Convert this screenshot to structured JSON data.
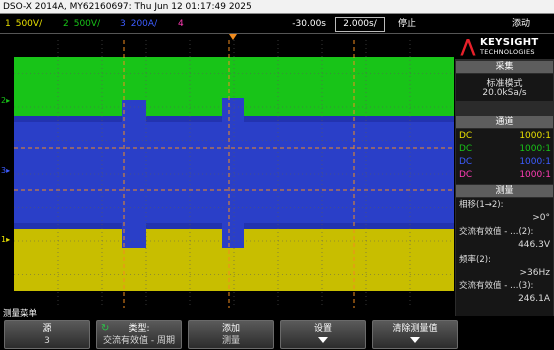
{
  "title_bar": "DSO-X 2014A, MY62160697: Thu Jun 12 01:17:49 2025",
  "channels": [
    {
      "num": "1",
      "scale": "500V/",
      "color": "#e8e000"
    },
    {
      "num": "2",
      "scale": "500V/",
      "color": "#18c418"
    },
    {
      "num": "3",
      "scale": "200A/",
      "color": "#3c5cff"
    },
    {
      "num": "4",
      "scale": "",
      "color": "#ff3cb4"
    }
  ],
  "time_offset": "-30.00s",
  "time_base": "2.000s/",
  "run_state": "停止",
  "trigger_mode": "添动",
  "ground_markers": {
    "ch2": "2",
    "ch3": "3",
    "ch1": "1"
  },
  "brand": {
    "name": "KEYSIGHT",
    "sub": "TECHNOLOGIES",
    "mark": "⋀"
  },
  "acquisition": {
    "header": "采集",
    "mode": "标准模式",
    "rate": "20.0kSa/s"
  },
  "channel_panel": {
    "header": "通道",
    "rows": [
      {
        "coupling": "DC",
        "probe": "1000:1",
        "color": "#e8e000"
      },
      {
        "coupling": "DC",
        "probe": "1000:1",
        "color": "#18c418"
      },
      {
        "coupling": "DC",
        "probe": "1000:1",
        "color": "#3c5cff"
      },
      {
        "coupling": "DC",
        "probe": "1000:1",
        "color": "#ff3cb4"
      }
    ]
  },
  "measurements": {
    "header": "测量",
    "items": [
      {
        "label": "相移(1→2):",
        "value": ">0°"
      },
      {
        "label": "交流有效值 - …(2):",
        "value": "446.3V"
      },
      {
        "label": "频率(2):",
        "value": ">36Hz"
      },
      {
        "label": "交流有效值 - …(3):",
        "value": "246.1A"
      }
    ]
  },
  "menu_title": "测量菜单",
  "softkeys": [
    {
      "label": "源",
      "sub": "3",
      "arrow": false
    },
    {
      "label": "类型:",
      "sub": "交流有效值 - 周期",
      "arrow": false
    },
    {
      "label": "添加",
      "sub": "测量",
      "arrow": false
    },
    {
      "label": "设置",
      "sub": "",
      "arrow": true
    },
    {
      "label": "清除测量值",
      "sub": "",
      "arrow": true
    }
  ],
  "colors": {
    "trigger": "#f28c1e",
    "ch1": "#e8e000",
    "ch2": "#18c418",
    "ch3": "#3c5cff",
    "ch4": "#ff3cb4"
  }
}
